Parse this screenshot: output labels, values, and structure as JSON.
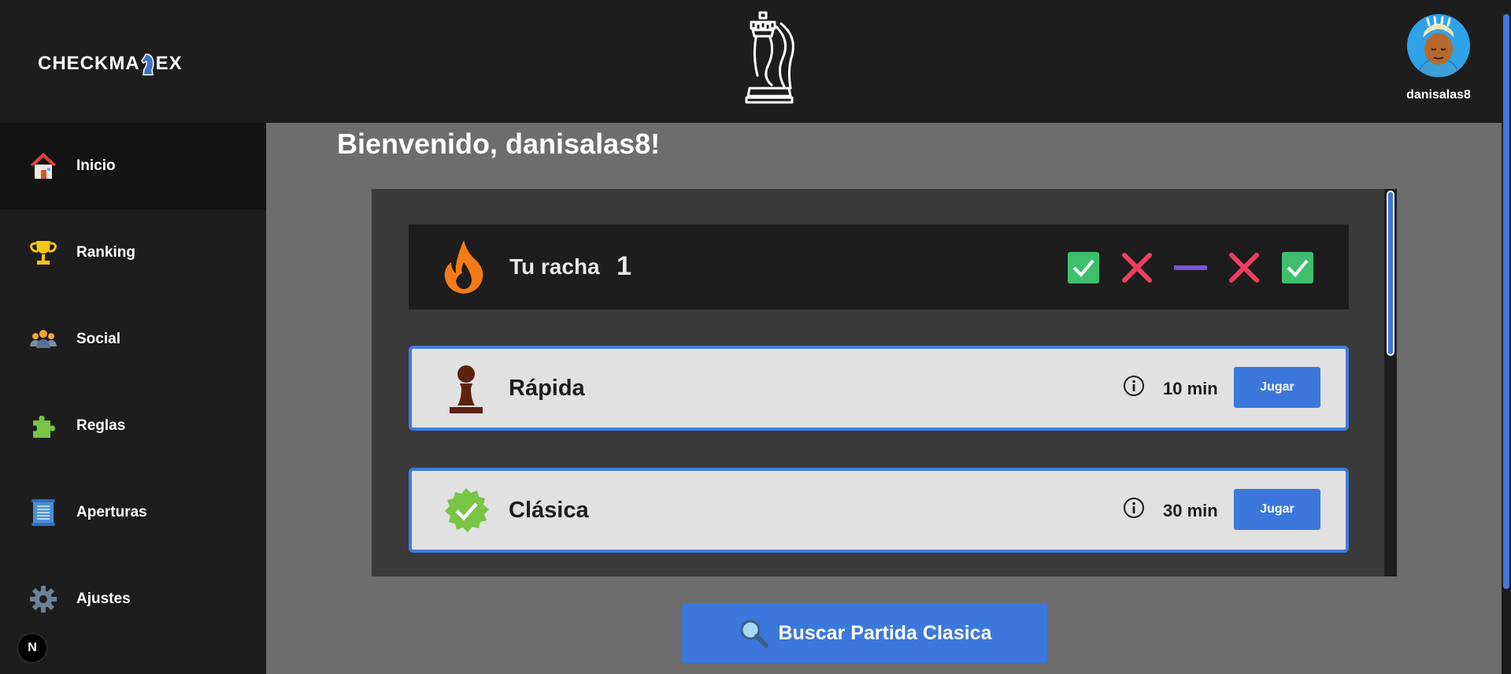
{
  "header": {
    "brand_before": "CHECKMA",
    "brand_after": "EX",
    "username": "danisalas8"
  },
  "sidebar": {
    "items": [
      {
        "label": "Inicio",
        "icon": "house-icon"
      },
      {
        "label": "Ranking",
        "icon": "trophy-icon"
      },
      {
        "label": "Social",
        "icon": "people-icon"
      },
      {
        "label": "Reglas",
        "icon": "puzzle-icon"
      },
      {
        "label": "Aperturas",
        "icon": "scroll-icon"
      },
      {
        "label": "Ajustes",
        "icon": "gear-icon"
      }
    ],
    "active": "Inicio",
    "badge": "N"
  },
  "main": {
    "welcome": "Bienvenido, danisalas8!",
    "streak": {
      "label": "Tu racha",
      "count": "1",
      "results": [
        "win",
        "loss",
        "draw",
        "loss",
        "win"
      ]
    },
    "modes": [
      {
        "name": "Rápida",
        "time": "10 min",
        "button": "Jugar",
        "icon": "pawn-icon"
      },
      {
        "name": "Clásica",
        "time": "30 min",
        "button": "Jugar",
        "icon": "verified-badge-icon"
      }
    ],
    "search_button": "Buscar Partida Clasica"
  },
  "colors": {
    "accent": "#3c78dc",
    "header_bg": "#1d1d1d",
    "content_bg": "#6d6d6d",
    "panel_bg": "#3a3a3a",
    "win": "#3fbf6e",
    "loss": "#f03d62",
    "draw": "#7a55d6"
  }
}
